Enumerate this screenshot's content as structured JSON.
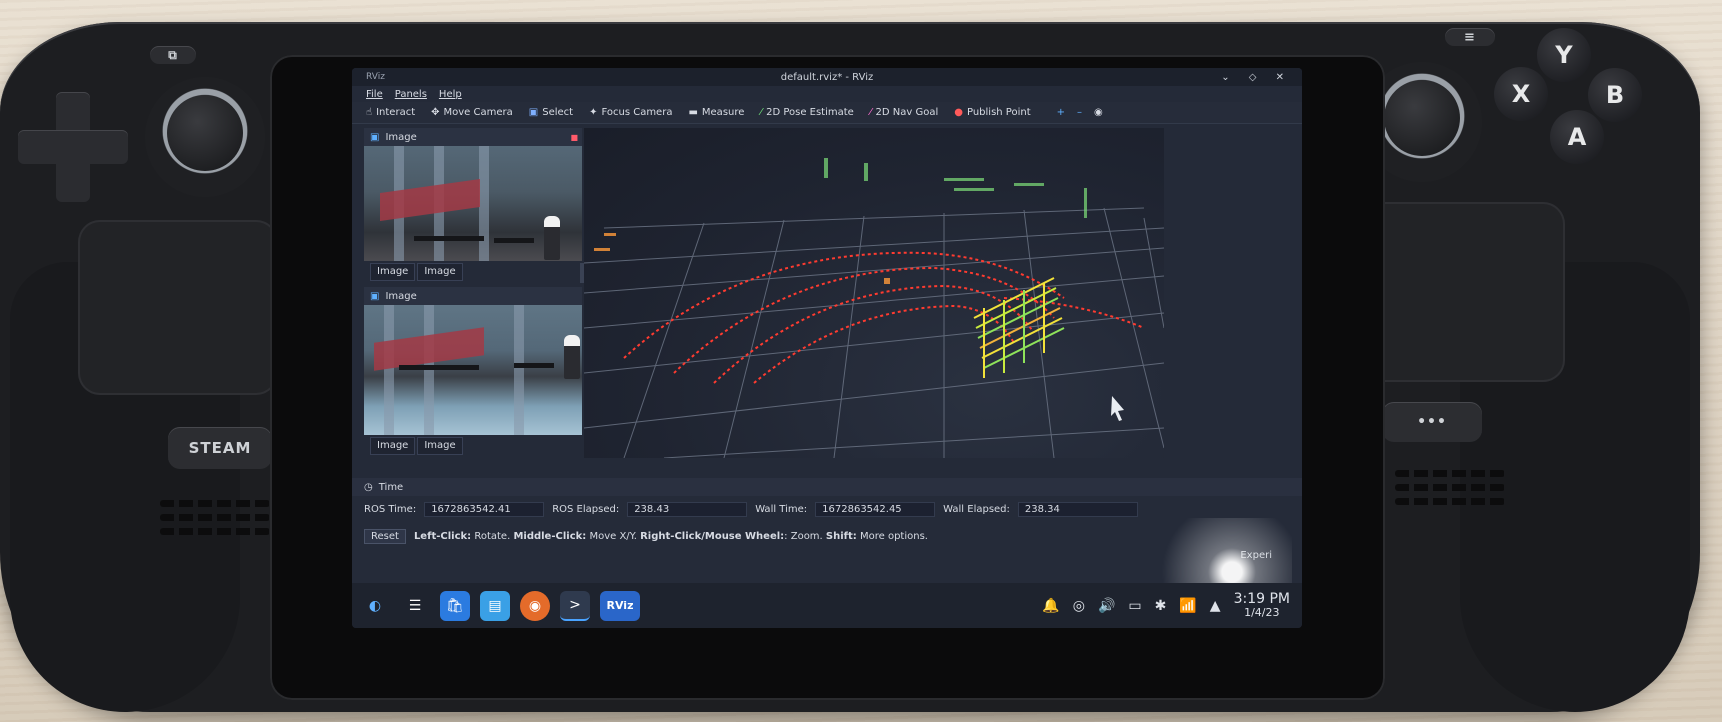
{
  "window": {
    "title": "default.rviz* - RViz",
    "logo_text": "RViz",
    "controls": "⌄ ◇ ✕"
  },
  "menu": [
    "File",
    "Panels",
    "Help"
  ],
  "toolbar": [
    {
      "label": "Interact",
      "icon": "hand-icon",
      "glyph": "☝"
    },
    {
      "label": "Move Camera",
      "icon": "move-icon",
      "glyph": "✥"
    },
    {
      "label": "Select",
      "icon": "select-icon",
      "glyph": "▣"
    },
    {
      "label": "Focus Camera",
      "icon": "focus-icon",
      "glyph": "✦"
    },
    {
      "label": "Measure",
      "icon": "ruler-icon",
      "glyph": "▬"
    },
    {
      "label": "2D Pose Estimate",
      "icon": "pose-arrow-icon",
      "glyph": "⁄"
    },
    {
      "label": "2D Nav Goal",
      "icon": "nav-arrow-icon",
      "glyph": "⁄"
    },
    {
      "label": "Publish Point",
      "icon": "pin-icon",
      "glyph": "●"
    }
  ],
  "toolbar_right": [
    "+",
    "–",
    "◉"
  ],
  "image_panels": [
    {
      "title": "Image",
      "tabs": [
        "Image",
        "Image"
      ]
    },
    {
      "title": "Image",
      "tabs": [
        "Image",
        "Image"
      ]
    }
  ],
  "time": {
    "title": "Time",
    "ros_time_label": "ROS Time:",
    "ros_time": "1672863542.41",
    "ros_elapsed_label": "ROS Elapsed:",
    "ros_elapsed": "238.43",
    "wall_time_label": "Wall Time:",
    "wall_time": "1672863542.45",
    "wall_elapsed_label": "Wall Elapsed:",
    "wall_elapsed": "238.34",
    "experimental": "Experi"
  },
  "hint": {
    "reset": "Reset",
    "text_parts": [
      {
        "b": "Left-Click:",
        "t": " Rotate. "
      },
      {
        "b": "Middle-Click:",
        "t": " Move X/Y. "
      },
      {
        "b": "Right-Click/Mouse Wheel:",
        "t": ": Zoom. "
      },
      {
        "b": "Shift:",
        "t": " More options."
      }
    ]
  },
  "taskbar": {
    "apps": [
      {
        "name": "app-launcher-icon",
        "glyph": "◐",
        "bg": "#1e232e"
      },
      {
        "name": "system-settings-icon",
        "glyph": "☰",
        "bg": "#1e232e"
      },
      {
        "name": "discover-store-icon",
        "glyph": "🛍",
        "bg": "#2b7be0"
      },
      {
        "name": "file-manager-icon",
        "glyph": "▤",
        "bg": "#3aa0e6"
      },
      {
        "name": "firefox-icon",
        "glyph": "◉",
        "bg": "#e46b2a"
      },
      {
        "name": "terminal-icon",
        "glyph": ">",
        "bg": "#2f3a4e"
      },
      {
        "name": "rviz-app-icon",
        "glyph": "RViz",
        "bg": "#2a66c9"
      }
    ],
    "tray": [
      "🔔",
      "◎",
      "🔊",
      "▭",
      "✱",
      "📶",
      "▲"
    ],
    "clock_time": "3:19 PM",
    "clock_date": "1/4/23"
  },
  "device": {
    "steam_button": "STEAM",
    "menu_button_glyph": "≡",
    "view_button_glyph": "⧉",
    "dots_button": "•••",
    "face_buttons": {
      "y": "Y",
      "x": "X",
      "b": "B",
      "a": "A"
    }
  }
}
